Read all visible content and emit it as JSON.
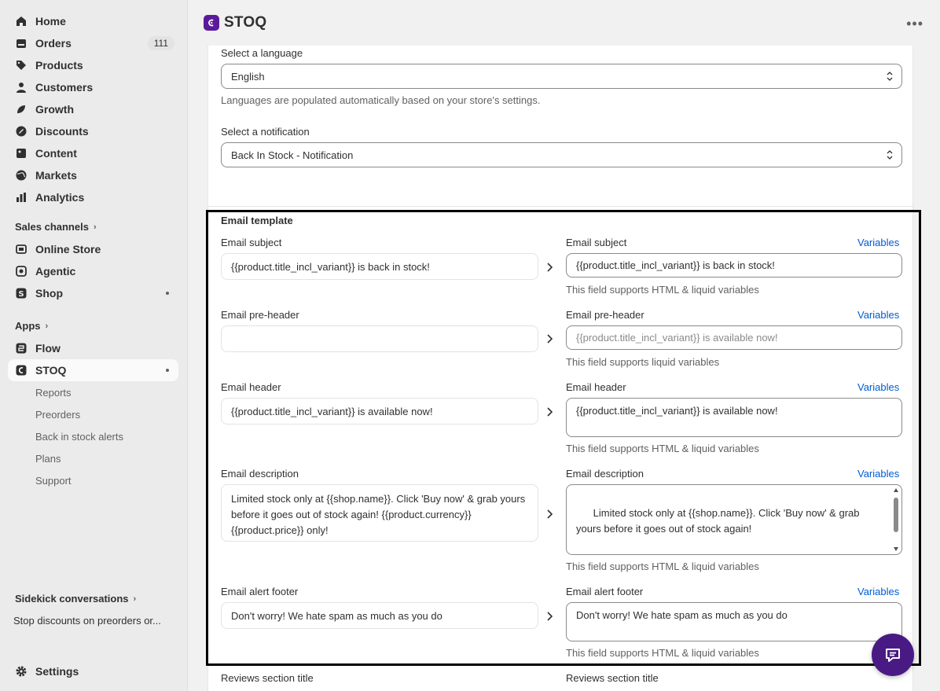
{
  "sidebar": {
    "items": [
      {
        "label": "Home",
        "icon": "home-icon"
      },
      {
        "label": "Orders",
        "icon": "orders-icon",
        "badge": "111"
      },
      {
        "label": "Products",
        "icon": "tag-icon"
      },
      {
        "label": "Customers",
        "icon": "person-icon"
      },
      {
        "label": "Growth",
        "icon": "growth-icon"
      },
      {
        "label": "Discounts",
        "icon": "discount-icon"
      },
      {
        "label": "Content",
        "icon": "content-icon"
      },
      {
        "label": "Markets",
        "icon": "globe-icon"
      },
      {
        "label": "Analytics",
        "icon": "analytics-icon"
      }
    ],
    "sales_channels_label": "Sales channels",
    "channels": [
      {
        "label": "Online Store",
        "icon": "store-icon"
      },
      {
        "label": "Agentic",
        "icon": "agentic-icon"
      },
      {
        "label": "Shop",
        "icon": "shop-icon"
      }
    ],
    "apps_label": "Apps",
    "apps": [
      {
        "label": "Flow",
        "icon": "flow-icon"
      },
      {
        "label": "STOQ",
        "icon": "stoq-icon"
      }
    ],
    "stoq_subitems": [
      "Reports",
      "Preorders",
      "Back in stock alerts",
      "Plans",
      "Support"
    ],
    "sidekick_label": "Sidekick conversations",
    "sidekick_item": "Stop discounts on preorders or...",
    "settings_label": "Settings"
  },
  "topbar": {
    "app_title": "STOQ"
  },
  "language": {
    "label": "Select a language",
    "value": "English",
    "help": "Languages are populated automatically based on your store's settings."
  },
  "notification": {
    "label": "Select a notification",
    "value": "Back In Stock - Notification"
  },
  "template": {
    "heading": "Email template",
    "variables_label": "Variables",
    "fields": [
      {
        "label": "Email subject",
        "default_value": "{{product.title_incl_variant}} is back in stock!",
        "custom_value": "{{product.title_incl_variant}} is back in stock!",
        "help": "This field supports HTML & liquid variables"
      },
      {
        "label": "Email pre-header",
        "default_value": "",
        "custom_placeholder": "{{product.title_incl_variant}} is available now!",
        "help": "This field supports liquid variables"
      },
      {
        "label": "Email header",
        "default_value": "{{product.title_incl_variant}} is available now!",
        "custom_value": "{{product.title_incl_variant}} is available now!",
        "help": "This field supports HTML & liquid variables"
      },
      {
        "label": "Email description",
        "default_value": "Limited stock only at {{shop.name}}. Click 'Buy now' & grab yours before it goes out of stock again! {{product.currency}} {{product.price}} only!",
        "custom_value": "Limited stock only at {{shop.name}}. Click 'Buy now' & grab yours before it goes out of stock again!\n\n{{product.currency}} {{product.price}} only!",
        "help": "This field supports HTML & liquid variables"
      },
      {
        "label": "Email alert footer",
        "default_value": "Don't worry! We hate spam as much as you do",
        "custom_value": "Don't worry! We hate spam as much as you do",
        "help": "This field supports HTML & liquid variables"
      }
    ],
    "reviews_label": "Reviews section title"
  },
  "colors": {
    "accent_link": "#005bd3",
    "brand": "#5b1a9a"
  }
}
